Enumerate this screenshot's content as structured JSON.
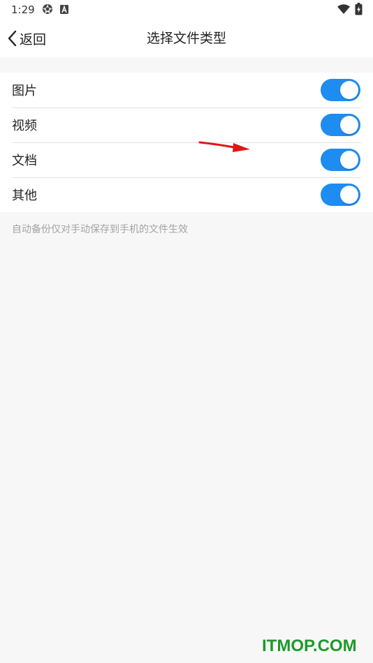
{
  "status_bar": {
    "time": "1:29",
    "icons": [
      "aperture-icon",
      "font-a-icon",
      "wifi-icon",
      "battery-charging-icon"
    ]
  },
  "nav": {
    "back_label": "返回",
    "title": "选择文件类型"
  },
  "settings": {
    "items": [
      {
        "label": "图片",
        "enabled": true
      },
      {
        "label": "视频",
        "enabled": true
      },
      {
        "label": "文档",
        "enabled": true
      },
      {
        "label": "其他",
        "enabled": true
      }
    ],
    "hint": "自动备份仅对手动保存到手机的文件生效"
  },
  "colors": {
    "toggle_on": "#1e8cf0",
    "annotation_arrow": "#e01818",
    "watermark": "#1d9a2a"
  },
  "watermark": {
    "text": "ITMOP.COM"
  }
}
